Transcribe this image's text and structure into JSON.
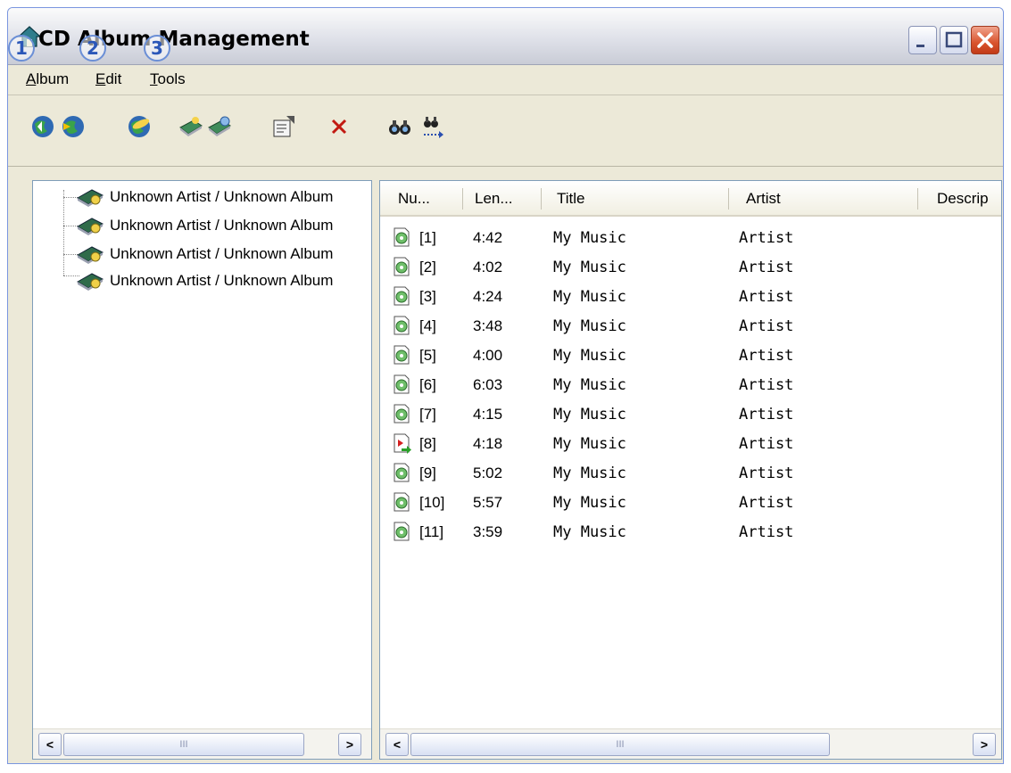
{
  "window": {
    "title": "CD Album Management"
  },
  "badges": [
    "1",
    "2",
    "3"
  ],
  "menu": [
    {
      "label": "Album",
      "mnemonic": "A"
    },
    {
      "label": "Edit",
      "mnemonic": "E"
    },
    {
      "label": "Tools",
      "mnemonic": "T"
    }
  ],
  "toolbar": {
    "icons": [
      "globe-back-icon",
      "globe-forward-icon",
      "cd-globe-icon",
      "cd-add-icon",
      "cd-edit-icon",
      "properties-icon",
      "delete-icon",
      "find-icon",
      "find-next-icon"
    ]
  },
  "tree": {
    "items": [
      {
        "label": "Unknown Artist / Unknown Album"
      },
      {
        "label": "Unknown Artist / Unknown Album"
      },
      {
        "label": "Unknown Artist / Unknown Album"
      },
      {
        "label": "Unknown Artist / Unknown Album"
      }
    ]
  },
  "tracks": {
    "columns": [
      "Nu...",
      "Len...",
      "Title",
      "Artist",
      "Descrip"
    ],
    "rows": [
      {
        "num": "[1]",
        "length": "4:42",
        "title": "My Music",
        "artist": "Artist",
        "icon": "cd-track-icon"
      },
      {
        "num": "[2]",
        "length": "4:02",
        "title": "My Music",
        "artist": "Artist",
        "icon": "cd-track-icon"
      },
      {
        "num": "[3]",
        "length": "4:24",
        "title": "My Music",
        "artist": "Artist",
        "icon": "cd-track-icon"
      },
      {
        "num": "[4]",
        "length": "3:48",
        "title": "My Music",
        "artist": "Artist",
        "icon": "cd-track-icon"
      },
      {
        "num": "[5]",
        "length": "4:00",
        "title": "My Music",
        "artist": "Artist",
        "icon": "cd-track-icon"
      },
      {
        "num": "[6]",
        "length": "6:03",
        "title": "My Music",
        "artist": "Artist",
        "icon": "cd-track-icon"
      },
      {
        "num": "[7]",
        "length": "4:15",
        "title": "My Music",
        "artist": "Artist",
        "icon": "cd-track-icon"
      },
      {
        "num": "[8]",
        "length": "4:18",
        "title": "My Music",
        "artist": "Artist",
        "icon": "media-track-icon"
      },
      {
        "num": "[9]",
        "length": "5:02",
        "title": "My Music",
        "artist": "Artist",
        "icon": "cd-track-icon"
      },
      {
        "num": "[10]",
        "length": "5:57",
        "title": "My Music",
        "artist": "Artist",
        "icon": "cd-track-icon"
      },
      {
        "num": "[11]",
        "length": "3:59",
        "title": "My Music",
        "artist": "Artist",
        "icon": "cd-track-icon"
      }
    ]
  },
  "scroll": {
    "left_arrow": "<",
    "right_arrow": ">",
    "grip": "III"
  }
}
